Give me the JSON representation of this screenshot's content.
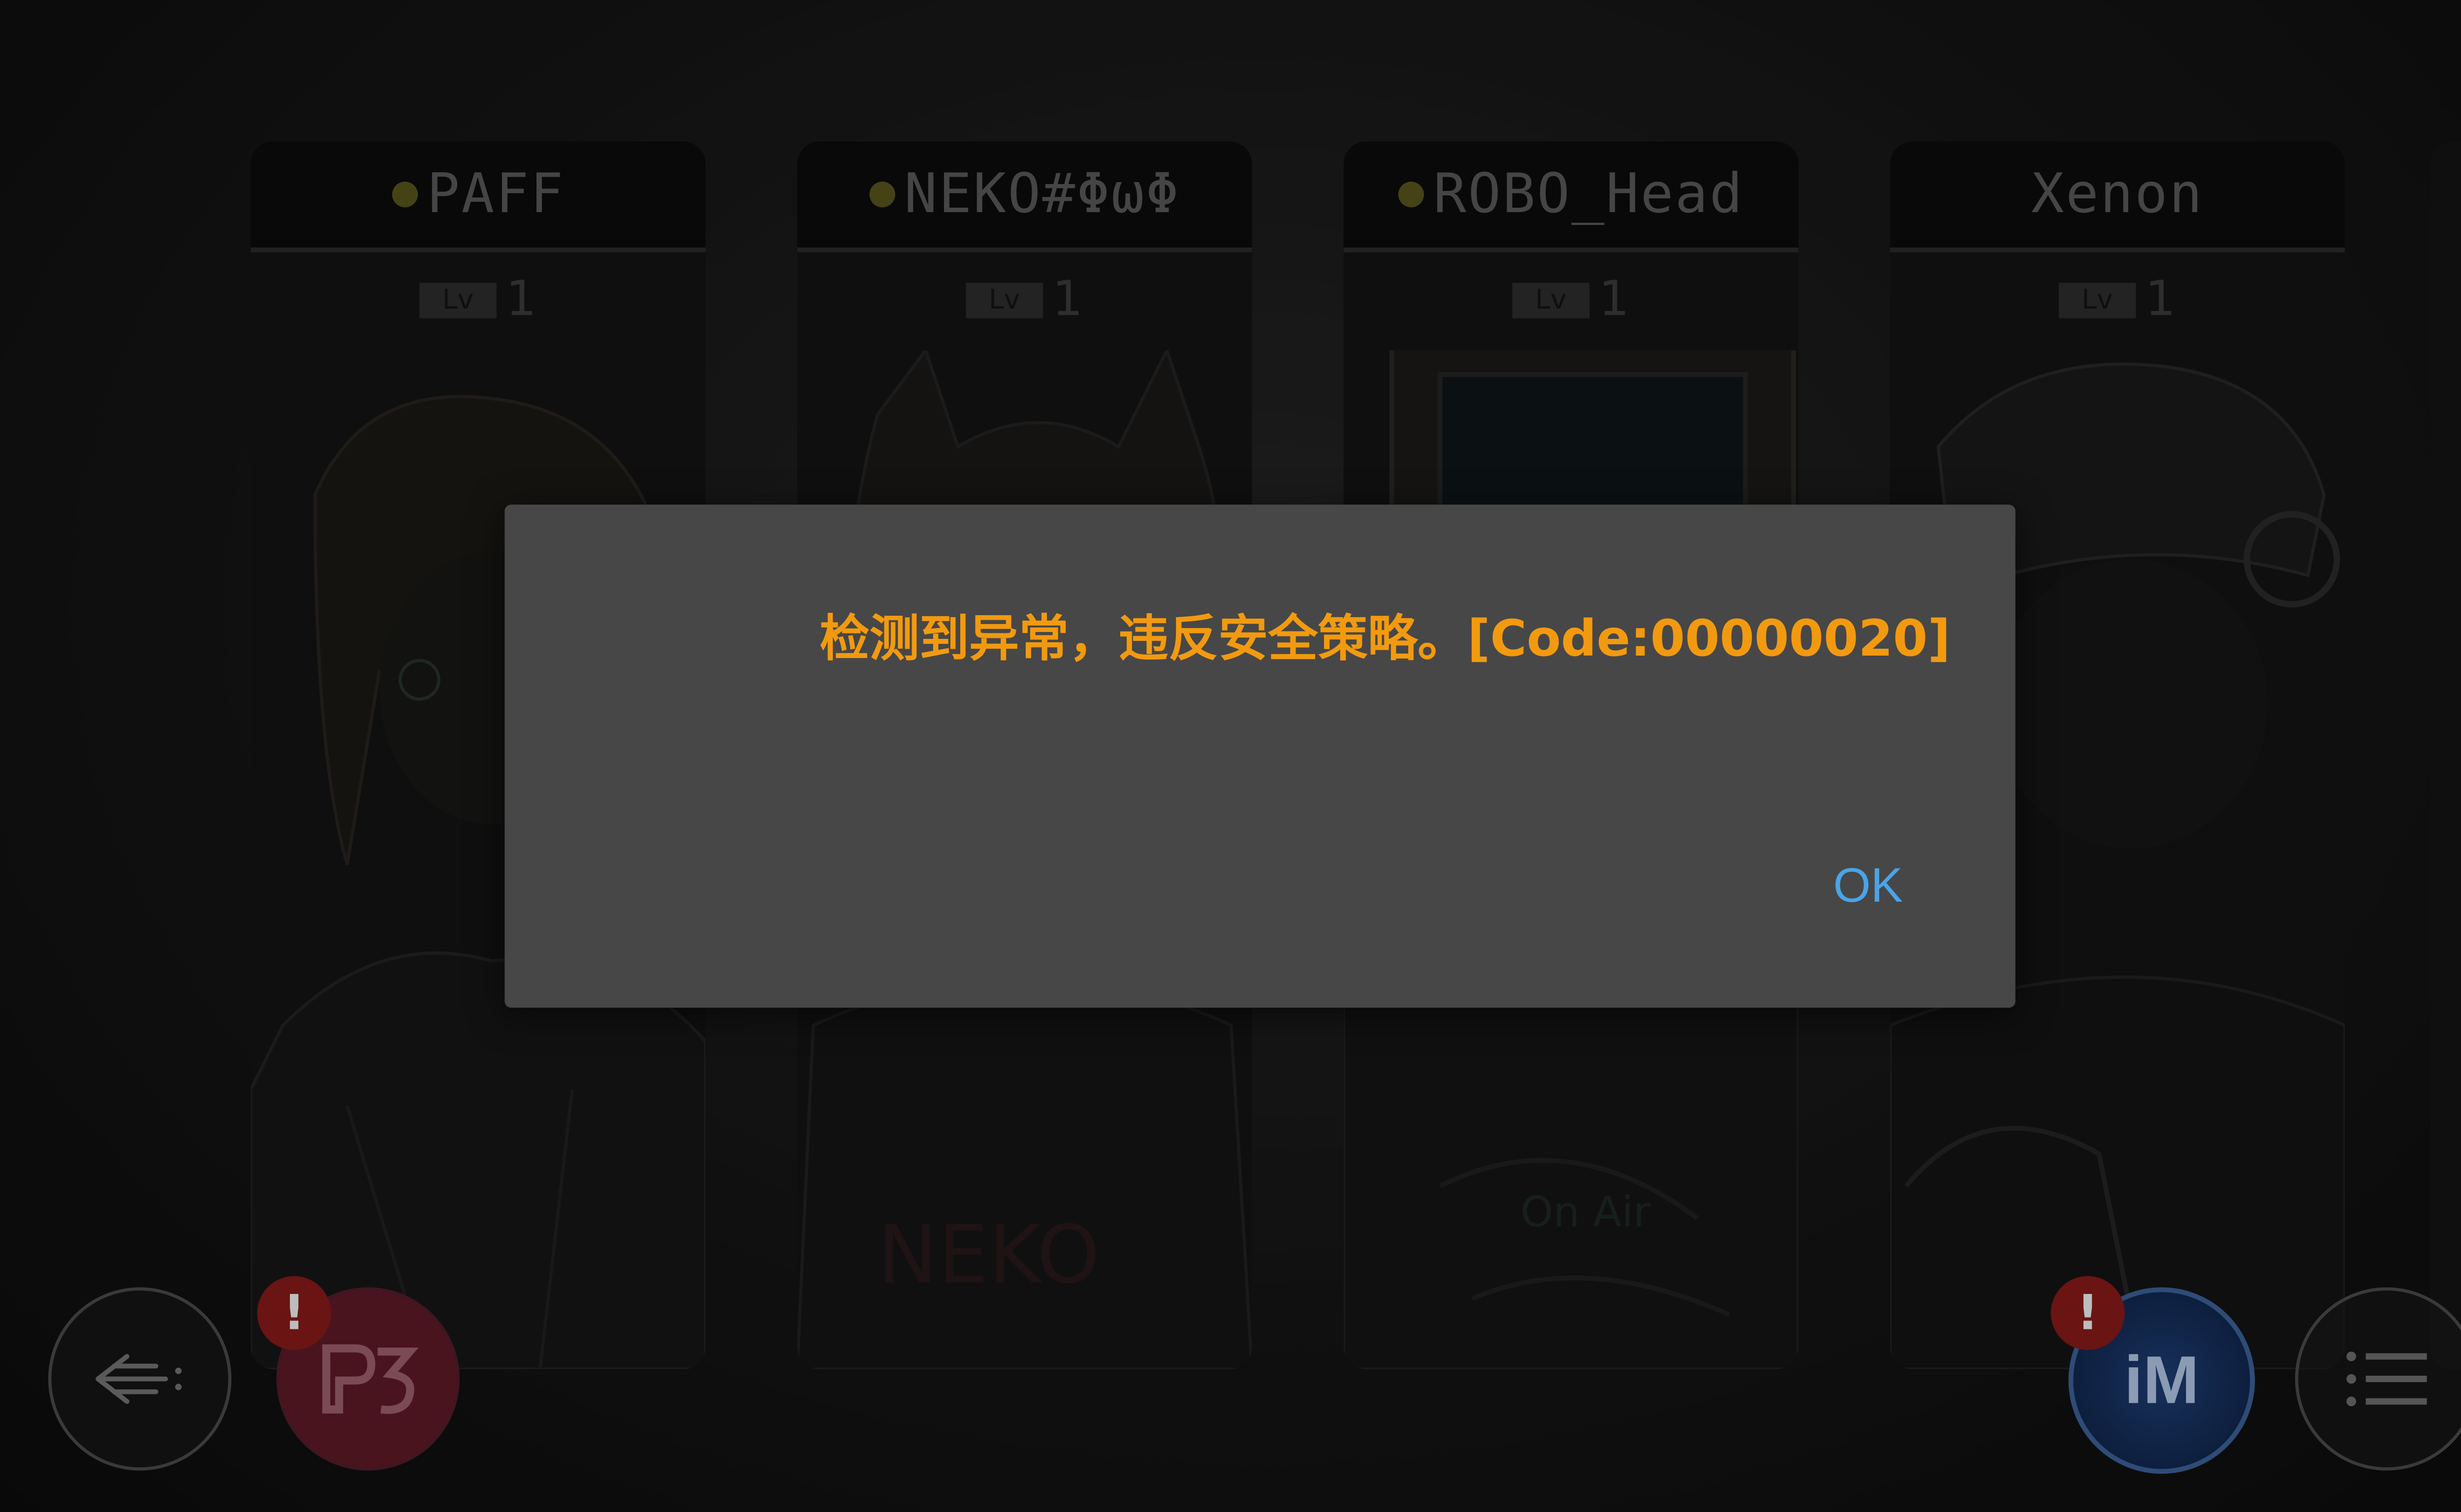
{
  "characters": [
    {
      "name": "PAFF",
      "status_dot": true,
      "level_label": "Lv",
      "level": "1"
    },
    {
      "name": "NEKO#ΦωΦ",
      "status_dot": true,
      "level_label": "Lv",
      "level": "1"
    },
    {
      "name": "ROBO_Head",
      "status_dot": true,
      "level_label": "Lv",
      "level": "1"
    },
    {
      "name": "Xenon",
      "status_dot": false,
      "level_label": "Lv",
      "level": "1"
    }
  ],
  "bottom_bar": {
    "back_icon": "back-arrow-icon",
    "p3_icon": "p3-logo-icon",
    "im_label": "iM",
    "menu_icon": "menu-list-icon",
    "alert_mark": "!"
  },
  "dialog": {
    "message": "检测到异常，违反安全策略。[Code:00000020]",
    "ok_label": "OK"
  },
  "colors": {
    "message": "#f29a0f",
    "ok_button": "#4aa4e8",
    "dialog_bg": "#474747"
  }
}
